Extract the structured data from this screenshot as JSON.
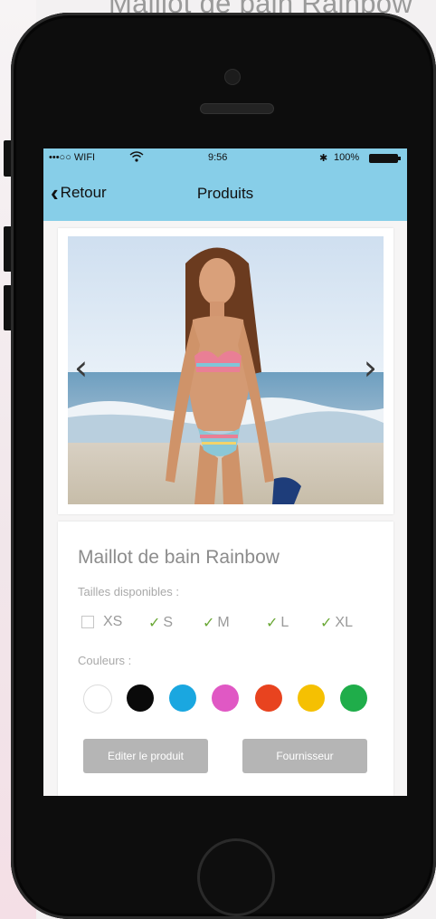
{
  "caption": "Maillot de bain Rainbow",
  "status_bar": {
    "carrier": "•••○○ WIFI",
    "time": "9:56",
    "battery": "100%"
  },
  "navbar": {
    "back_label": "Retour",
    "title": "Produits"
  },
  "product": {
    "name": "Maillot de bain Rainbow",
    "sizes_label": "Tailles disponibles :",
    "sizes": [
      {
        "label": "XS",
        "available": false
      },
      {
        "label": "S",
        "available": true
      },
      {
        "label": "M",
        "available": true
      },
      {
        "label": "L",
        "available": true
      },
      {
        "label": "XL",
        "available": true
      }
    ],
    "colors_label": "Couleurs :",
    "colors": [
      "#ffffff",
      "#0a0a0a",
      "#1aa7e0",
      "#e058c4",
      "#e8431f",
      "#f5c002",
      "#1fad4a"
    ]
  },
  "actions": {
    "edit_label": "Editer le produit",
    "supplier_label": "Fournisseur"
  },
  "icons": {
    "back": "chevron-left-icon",
    "prev": "chevron-left-icon",
    "next": "chevron-right-icon",
    "wifi": "wifi-icon",
    "battery": "battery-icon"
  },
  "theme": {
    "navbar_color": "#87cee8",
    "button_color": "#b5b5b5",
    "check_color": "#6aa836"
  }
}
